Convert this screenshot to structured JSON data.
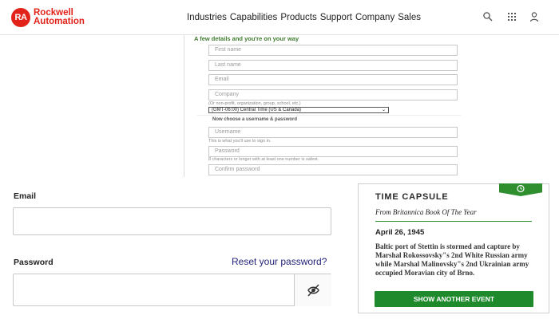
{
  "header": {
    "logo_badge": "RA",
    "logo_line1": "Rockwell",
    "logo_line2": "Automation",
    "nav": [
      "Industries",
      "Capabilities",
      "Products",
      "Support",
      "Company",
      "Sales"
    ],
    "icons": [
      "search-icon",
      "grid-menu-icon",
      "user-icon"
    ]
  },
  "registration": {
    "title": "A few details and you're on your way",
    "first_name": "First name",
    "last_name": "Last name",
    "email": "Email",
    "company": "Company",
    "company_hint": "(Or non-profit, organization, group, school, etc.)",
    "timezone": "(GMT-06:00) Central Time (US & Canada)",
    "credentials_heading": "Now choose a username & password",
    "username": "Username",
    "username_hint": "This is what you'll use to sign in.",
    "password": "Password",
    "password_hint": "8 characters or longer with at least one number is safest.",
    "confirm_password": "Confirm password"
  },
  "login": {
    "email_label": "Email",
    "email_value": "",
    "password_label": "Password",
    "password_value": "",
    "reset_link": "Reset your password?"
  },
  "time_capsule": {
    "title": "TIME CAPSULE",
    "subtitle": "From Britannica Book Of The Year",
    "date": "April 26, 1945",
    "body": "Baltic port of Stettin is stormed and capture by Marshal Rokossovsky\"s 2nd White Russian army while Marshal Malinovsky\"s 2nd Ukrainian army occupied Moravian city of Brno.",
    "button": "SHOW ANOTHER EVENT",
    "accent_color": "#1e8a2c"
  }
}
